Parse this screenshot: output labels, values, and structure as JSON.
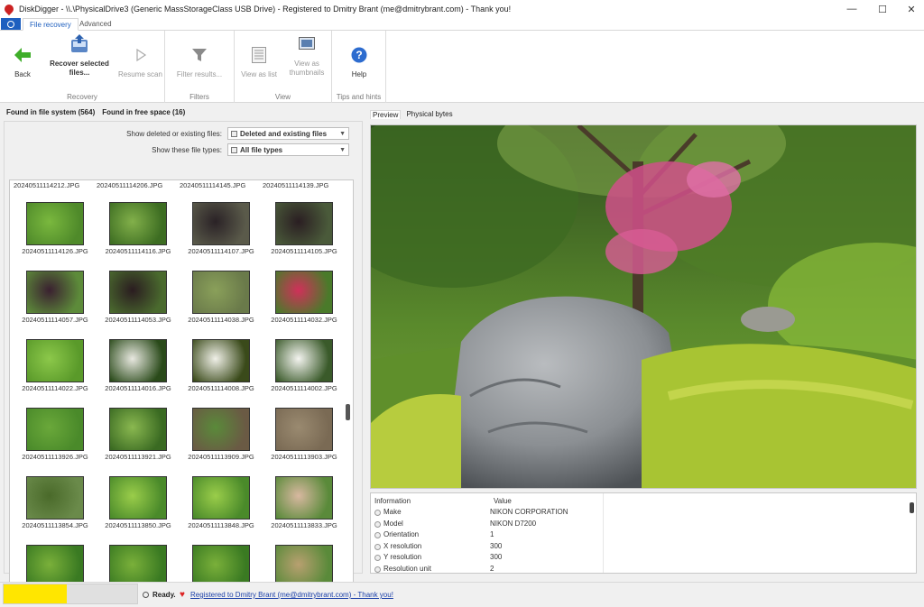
{
  "window": {
    "title": "DiskDigger - \\\\.\\PhysicalDrive3 (Generic MassStorageClass USB Drive) - Registered to Dmitry Brant (me@dmitrybrant.com) - Thank you!",
    "minimize_icon": "minimize-icon",
    "maximize_icon": "maximize-icon",
    "close_icon": "close-icon"
  },
  "ribbon_tabs": [
    "File recovery",
    "Advanced"
  ],
  "ribbon": {
    "groups": {
      "recovery": "Recovery",
      "filters": "Filters",
      "view": "View",
      "tips": "Tips and hints"
    },
    "buttons": {
      "back": "Back",
      "recover": "Recover selected\nfiles...",
      "resume": "Resume scan",
      "filter": "Filter results...",
      "list": "View as list",
      "thumbs": "View as\nthumbnails",
      "help": "Help"
    }
  },
  "left": {
    "tabs": [
      "Found in file system (564)",
      "Found in free space (16)"
    ],
    "show_deleted_label": "Show deleted or existing files:",
    "show_deleted_value": "Deleted and existing files",
    "show_types_label": "Show these file types:",
    "show_types_value": "All file types",
    "top_names": [
      "20240511114212.JPG",
      "20240511114206.JPG",
      "20240511114145.JPG",
      "20240511114139.JPG"
    ],
    "files": [
      "20240511114126.JPG",
      "20240511114116.JPG",
      "20240511114107.JPG",
      "20240511114105.JPG",
      "20240511114057.JPG",
      "20240511114053.JPG",
      "20240511114038.JPG",
      "20240511114032.JPG",
      "20240511114022.JPG",
      "20240511114016.JPG",
      "20240511114008.JPG",
      "20240511114002.JPG",
      "20240511113926.JPG",
      "20240511113921.JPG",
      "20240511113909.JPG",
      "20240511113903.JPG",
      "20240511113854.JPG",
      "20240511113850.JPG",
      "20240511113848.JPG",
      "20240511113833.JPG",
      "",
      "",
      "",
      ""
    ]
  },
  "right": {
    "tabs": [
      "Preview",
      "Physical bytes"
    ],
    "info_header": [
      "Information",
      "Value"
    ],
    "info": [
      {
        "k": "Make",
        "v": "NIKON CORPORATION"
      },
      {
        "k": "Model",
        "v": "NIKON D7200"
      },
      {
        "k": "Orientation",
        "v": "1"
      },
      {
        "k": "X resolution",
        "v": "300"
      },
      {
        "k": "Y resolution",
        "v": "300"
      },
      {
        "k": "Resolution unit",
        "v": "2"
      }
    ]
  },
  "status": {
    "text": "Ready.",
    "link": "Registered to Dmitry Brant (me@dmitrybrant.com) - Thank you!",
    "progress": 0.47
  },
  "colors": {
    "accent": "#1e5fbf",
    "progress": "#ffe600"
  }
}
